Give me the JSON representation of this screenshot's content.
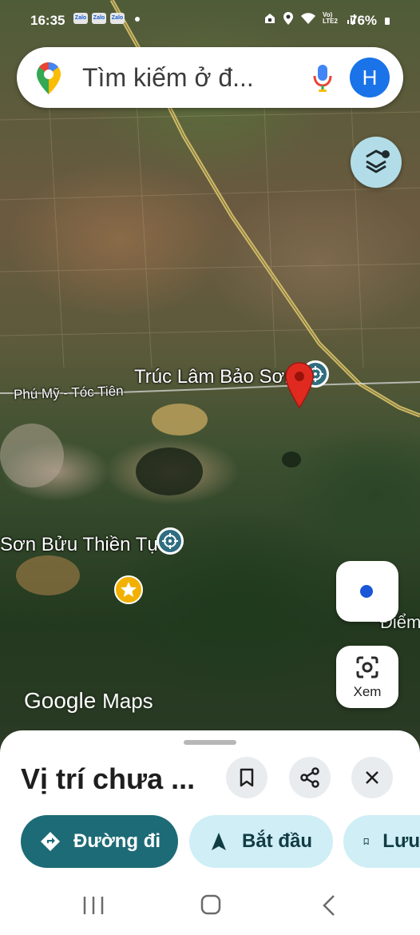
{
  "status_bar": {
    "time": "16:35",
    "notification_apps": [
      "Zalo",
      "Zalo",
      "Zalo"
    ],
    "network": "Vo) LTE2",
    "battery": "76%"
  },
  "search": {
    "placeholder": "Tìm kiếm ở đ...",
    "avatar_initial": "H"
  },
  "map": {
    "labels": {
      "road": "Phú Mỹ - Tóc Tiên",
      "place_1": "Trúc Lâm Bảo Sơn",
      "place_2": "Sơn Bửu Thiền Tự",
      "place_3": "Điểm"
    },
    "xem_label": "Xem",
    "logo_google": "Google",
    "logo_maps": "Maps"
  },
  "sheet": {
    "title": "Vị trí chưa ...",
    "actions": {
      "directions": "Đường đi",
      "start": "Bắt đầu",
      "save": "Lưu"
    }
  },
  "colors": {
    "accent_teal": "#1d6b76",
    "chip_bg": "#cfeef5",
    "pin_red": "#e02a20",
    "avatar_blue": "#1a73e8"
  }
}
